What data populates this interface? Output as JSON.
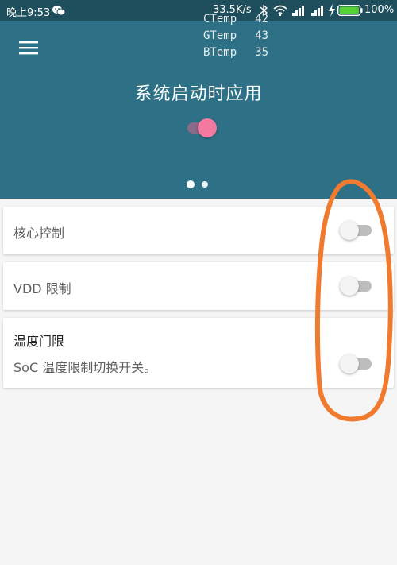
{
  "status_bar": {
    "time": "晚上9:53",
    "net_speed": "33.5K/s",
    "battery_percent": "100%"
  },
  "temps": [
    {
      "label": "CTemp",
      "value": "42"
    },
    {
      "label": "GTemp",
      "value": "43"
    },
    {
      "label": "BTemp",
      "value": "35"
    }
  ],
  "header": {
    "title": "系统启动时应用",
    "toggle_on": true,
    "page_indicator": {
      "count": 2,
      "active": 1
    }
  },
  "settings": [
    {
      "label": "核心控制",
      "enabled": false
    },
    {
      "label": "VDD 限制",
      "enabled": false
    },
    {
      "title": "温度门限",
      "subtitle": "SoC 温度限制切换开关。",
      "enabled": false
    }
  ],
  "colors": {
    "header": "#2e7186",
    "status_bar": "#1f4f5c",
    "accent": "#f27aa1",
    "annotation": "#f07a2e"
  },
  "icons": [
    "wechat-icon",
    "bluetooth-icon",
    "wifi-icon",
    "signal-icon",
    "charging-icon",
    "battery-icon",
    "menu-icon"
  ]
}
